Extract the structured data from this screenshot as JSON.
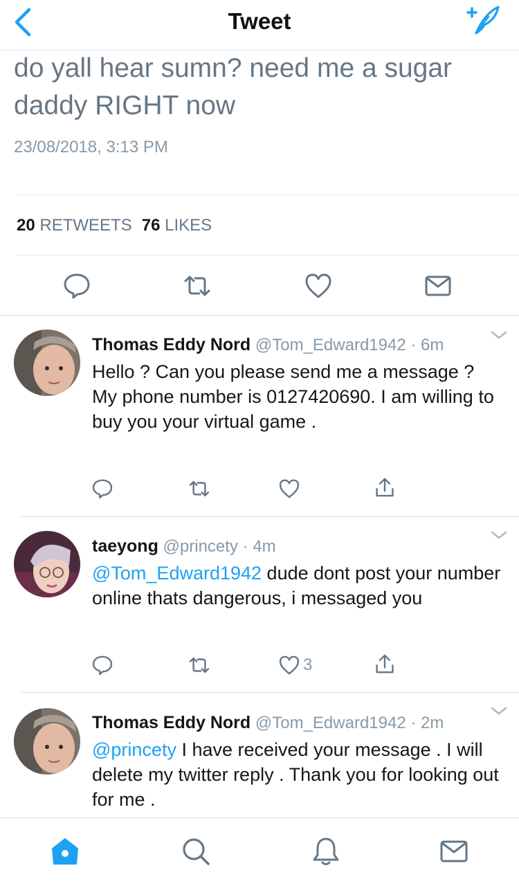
{
  "header": {
    "title": "Tweet",
    "back_icon": "chevron-left-icon",
    "compose_icon": "compose-feather-icon"
  },
  "tweet": {
    "text": "do yall hear sumn? need me a sugar daddy RIGHT now",
    "date": "23/08/2018, 3:13 PM",
    "retweets_count": "20",
    "retweets_label": "RETWEETS",
    "likes_count": "76",
    "likes_label": "LIKES"
  },
  "actions": [
    "reply-icon",
    "retweet-icon",
    "like-icon",
    "message-icon"
  ],
  "replies": [
    {
      "name": "Thomas Eddy Nord",
      "handle": "@Tom_Edward1942",
      "time": "· 6m",
      "mention": "",
      "text": "Hello ? Can you please send me a message ? My phone number is 0127420690. I am willing to buy you your virtual game .",
      "like_count": ""
    },
    {
      "name": "taeyong",
      "handle": "@princety",
      "time": "· 4m",
      "mention": "@Tom_Edward1942",
      "text": " dude dont post your number online thats dangerous, i messaged you",
      "like_count": "3"
    },
    {
      "name": "Thomas Eddy Nord",
      "handle": "@Tom_Edward1942",
      "time": "· 2m",
      "mention": "@princety",
      "text": " I have received your message . I will delete my twitter reply . Thank you for looking out for me .",
      "like_count": ""
    }
  ],
  "tabbar": [
    "home-icon",
    "search-icon",
    "notifications-bell-icon",
    "messages-icon"
  ],
  "colors": {
    "accent": "#1da1f2",
    "text": "#14171a",
    "muted": "#8899a6",
    "icon": "#657786",
    "divider": "#e1e8ed"
  }
}
